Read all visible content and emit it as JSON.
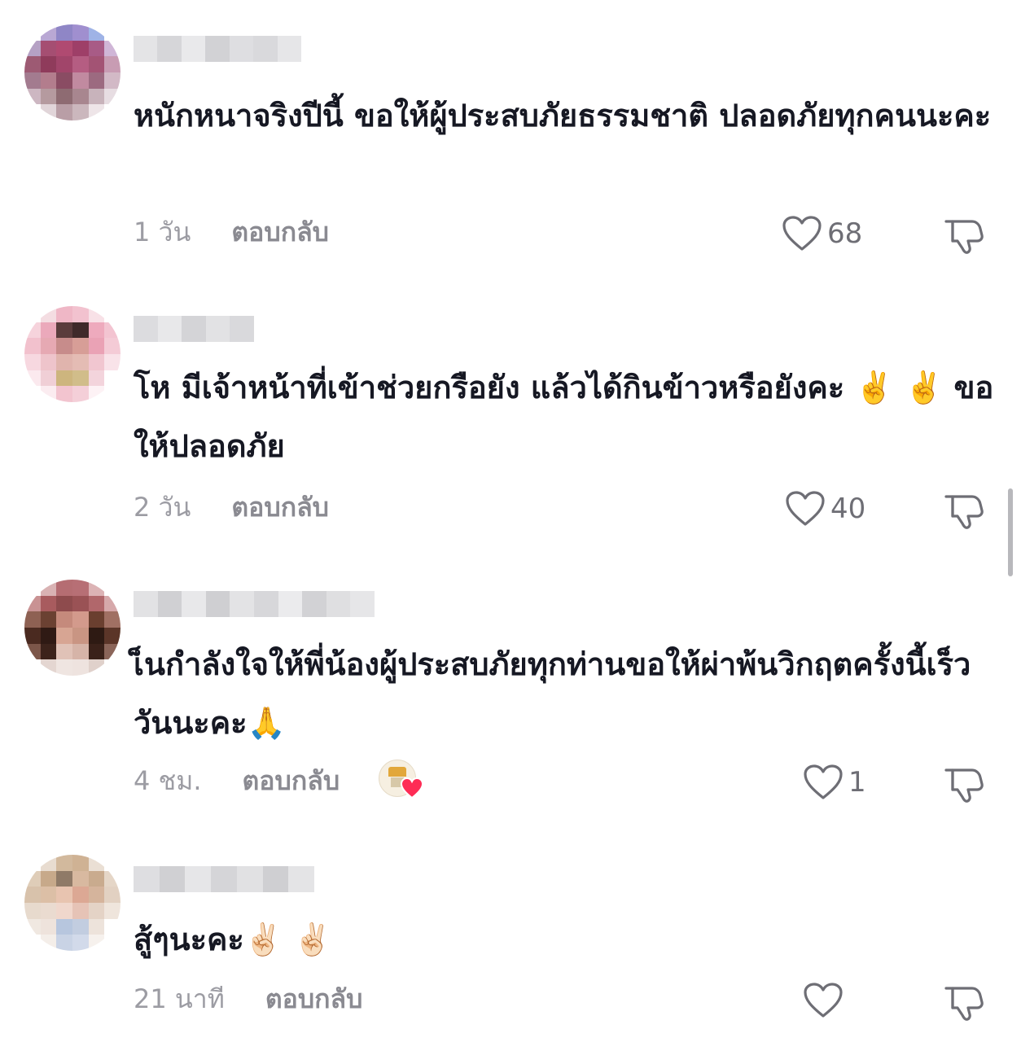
{
  "comments": [
    {
      "text": "หนักหนาจริงปีนี้ ขอให้ผู้ประสบภัยธรรมชาติ ปลอดภัยทุกคนนะคะ",
      "time": "1 วัน",
      "reply": "ตอบกลับ",
      "likes": "68"
    },
    {
      "text": "โห มีเจ้าหน้าที่เข้าช่วยกรือยัง แล้วได้กินข้าวหรือยังคะ ✌️ ✌️ ขอให้ปลอดภัย",
      "time": "2 วัน",
      "reply": "ตอบกลับ",
      "likes": "40"
    },
    {
      "text": "เ็นกำลังใจให้พี่น้องผู้ประสบภัยทุกท่านขอให้ผ่าพ้นวิกฤตครั้งนี้เร็ววันนะคะ🙏",
      "time": "4 ชม.",
      "reply": "ตอบกลับ",
      "likes": "1"
    },
    {
      "text": "สู้ๆนะคะ✌🏻 ✌🏻",
      "time": "21 นาที",
      "reply": "ตอบกลับ",
      "likes": ""
    }
  ],
  "icons": {
    "like": "heart-outline-icon",
    "dislike": "thumbs-down-outline-icon",
    "creator_like": "creator-liked-heart-icon"
  },
  "colors": {
    "text": "#161823",
    "meta": "#9c9ca3",
    "icon": "#6e6e75",
    "creator_heart": "#fe2c55"
  }
}
